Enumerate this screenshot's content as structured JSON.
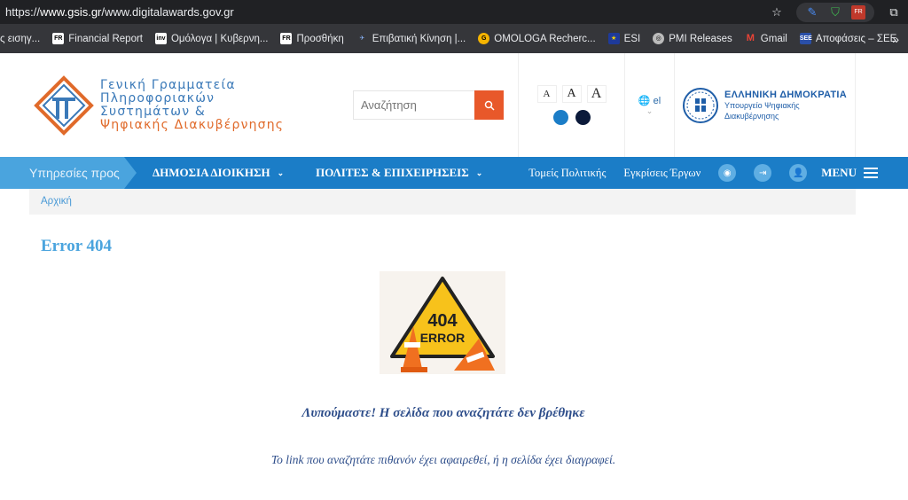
{
  "browser": {
    "url_prefix": "https://",
    "url_domain": "www.gsis.gr",
    "url_path": "/www.digitalawards.gov.gr",
    "bookmarks": [
      {
        "label": "ς εισηγ...",
        "icon": "none"
      },
      {
        "label": "Financial Report",
        "icon": "fr-favicon"
      },
      {
        "label": "Ομόλογα | Κυβερνη...",
        "icon": "inv-favicon"
      },
      {
        "label": "Προσθήκη",
        "icon": "fr-favicon"
      },
      {
        "label": "Επιβατική Κίνηση |...",
        "icon": "plane-favicon"
      },
      {
        "label": "OMOLOGA Recherc...",
        "icon": "g-favicon"
      },
      {
        "label": "ESI",
        "icon": "eu-favicon"
      },
      {
        "label": "PMI Releases",
        "icon": "globe-favicon"
      },
      {
        "label": "Gmail",
        "icon": "gmail-favicon"
      },
      {
        "label": "Αποφάσεις – ΣΕΕ",
        "icon": "doc-favicon"
      }
    ],
    "more_label": "»"
  },
  "header": {
    "logo_line1": "Γενική Γραμματεία",
    "logo_line2": "Πληροφοριακών",
    "logo_line3": "Συστημάτων &",
    "logo_line4": "Ψηφιακής Διακυβέρνησης",
    "search_placeholder": "Αναζήτηση",
    "font_small": "A",
    "font_medium": "A",
    "font_large": "A",
    "lang": "el",
    "gov_title": "ΕΛΛΗΝΙΚΗ ΔΗΜΟΚΡΑΤΙΑ",
    "gov_sub1": "Υπουργείο Ψηφιακής",
    "gov_sub2": "Διακυβέρνησης"
  },
  "nav": {
    "services_label": "Υπηρεσίες προς",
    "public_admin": "ΔΗΜΟΣΙΑ ΔΙΟΙΚΗΣΗ",
    "citizens": "ΠΟΛΙΤΕΣ & ΕΠΙΧΕΙΡΗΣΕΙΣ",
    "policy": "Τομείς Πολιτικής",
    "approvals": "Εγκρίσεις Έργων",
    "menu": "MENU"
  },
  "breadcrumb": {
    "home": "Αρχική"
  },
  "content": {
    "title": "Error 404",
    "image_text_1": "404",
    "image_text_2": "ERROR",
    "message": "Λυπούμαστε!  Η σελίδα που αναζητάτε δεν βρέθηκε",
    "details": "Το link  που αναζητάτε πιθανόν έχει αφαιρεθεί, ή η σελίδα έχει διαγραφεί."
  },
  "colors": {
    "nav_blue": "#1b7dc7",
    "nav_light": "#4aa4de",
    "search_orange": "#e8582a",
    "contrast_blue": "#1b7dc7",
    "contrast_dark": "#0b1a3a"
  }
}
